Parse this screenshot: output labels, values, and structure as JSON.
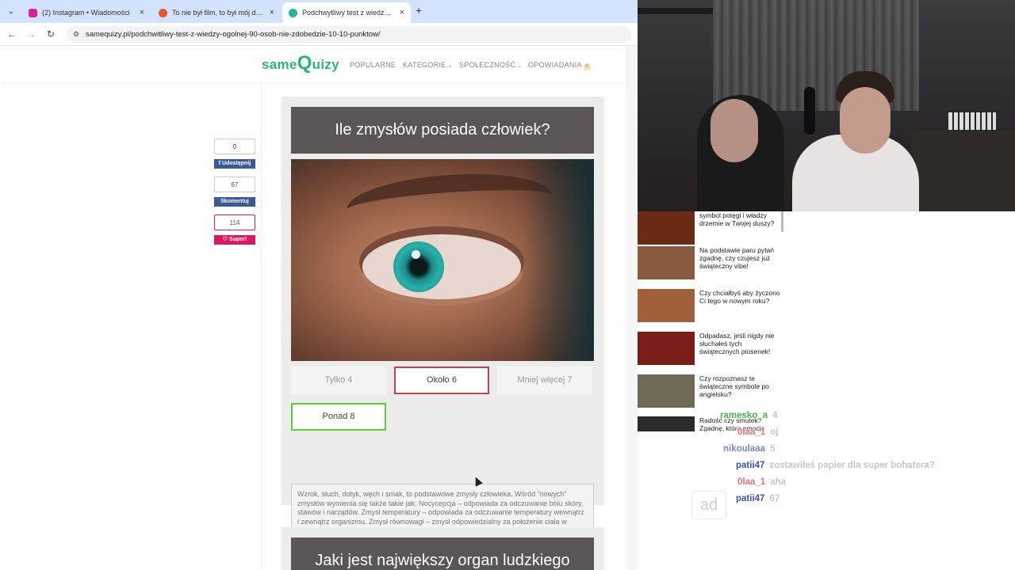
{
  "browser": {
    "tabs": [
      {
        "title": "(2) Instagram • Wiadomości",
        "favicon_color": "#d6249f"
      },
      {
        "title": "To nie był film, to był mój dzień",
        "favicon_color": "#e8552f"
      },
      {
        "title": "Podchwytliwy test z wiedzy ogó",
        "favicon_color": "#27b39a",
        "active": true
      }
    ],
    "url": "samequizy.pl/podchwitliwy-test-z-wiedzy-ogolnej-90-osob-nie-zdobedzie-10-10-punktow/"
  },
  "site": {
    "logo_prefix": "same",
    "logo_q": "Q",
    "logo_suffix": "uizy",
    "nav": [
      "POPULARNE",
      "KATEGORIE",
      "SPOŁECZNOŚĆ",
      "OPOWIADANIA"
    ],
    "nav_badge": "6"
  },
  "share": {
    "share_count": "0",
    "share_label": "Udostępnij",
    "comment_count": "67",
    "comment_label": "Skomentuj",
    "super_count": "114",
    "super_label": "Super!",
    "facebook_color": "#3b5998",
    "super_color": "#d81b60"
  },
  "question": {
    "title": "Ile zmysłów posiada człowiek?",
    "answers": [
      {
        "label": "Tylko 4",
        "state": "neutral"
      },
      {
        "label": "Około 6",
        "state": "wrong"
      },
      {
        "label": "Mniej więcej 7",
        "state": "neutral"
      },
      {
        "label": "Ponad 8",
        "state": "correct"
      }
    ],
    "explanation": "Wzrok, słuch, dotyk, węch i smak, to podstawowe zmysły człowieka. Wśród \"nowych\" zmysłów wymienia się także takie jak: Nocycepcja – odpowiada za odczuwanie bólu skóry, stawów i narządów. Zmysł temperatury – odpowiada za odczuwanie temperatury wewnątrz i zewnątrz organizmu. Zmysł równowagi – zmysł odpowiedzialny za położenie ciała w przestrzeni."
  },
  "next_question": {
    "title": "Jaki jest największy organ ludzkiego"
  },
  "related": [
    {
      "text": "symbol potęgi i władzy drzemie w Twojej duszy?",
      "thumb_color": "#6b2a14"
    },
    {
      "text": "Na podstawie paru pytań zgadnę, czy czujesz już świąteczny vibe!",
      "thumb_color": "#8a5a40"
    },
    {
      "text": "Czy chciałbyś aby życzono Ci tego w nowym roku?",
      "thumb_color": "#a0603c"
    },
    {
      "text": "Odpadasz, jeśli nigdy nie słuchałeś tych świątecznych piosenek!",
      "thumb_color": "#7a1e1a"
    },
    {
      "text": "Czy rozpoznasz te świąteczne symbole po angielsku?",
      "thumb_color": "#6e6a55"
    },
    {
      "text": "Radość czy smutek? Zgadnę, która emocja",
      "thumb_color": "#2a2a2a"
    }
  ],
  "chat": [
    {
      "user": "ramesko_a",
      "msg": "4",
      "color": "#4caf50"
    },
    {
      "user": "0laa_1",
      "msg": "oj",
      "color": "#e57373"
    },
    {
      "user": "nikoulaaa",
      "msg": "5",
      "color": "#7986cb"
    },
    {
      "user": "patii47",
      "msg": "zostawiłeś papier dla super bohatera?",
      "color": "#3f51b5"
    },
    {
      "user": "0laa_1",
      "msg": "aha",
      "color": "#e57373"
    },
    {
      "user": "patii47",
      "msg": "67",
      "color": "#3f51b5"
    }
  ],
  "ad_label": "ad"
}
